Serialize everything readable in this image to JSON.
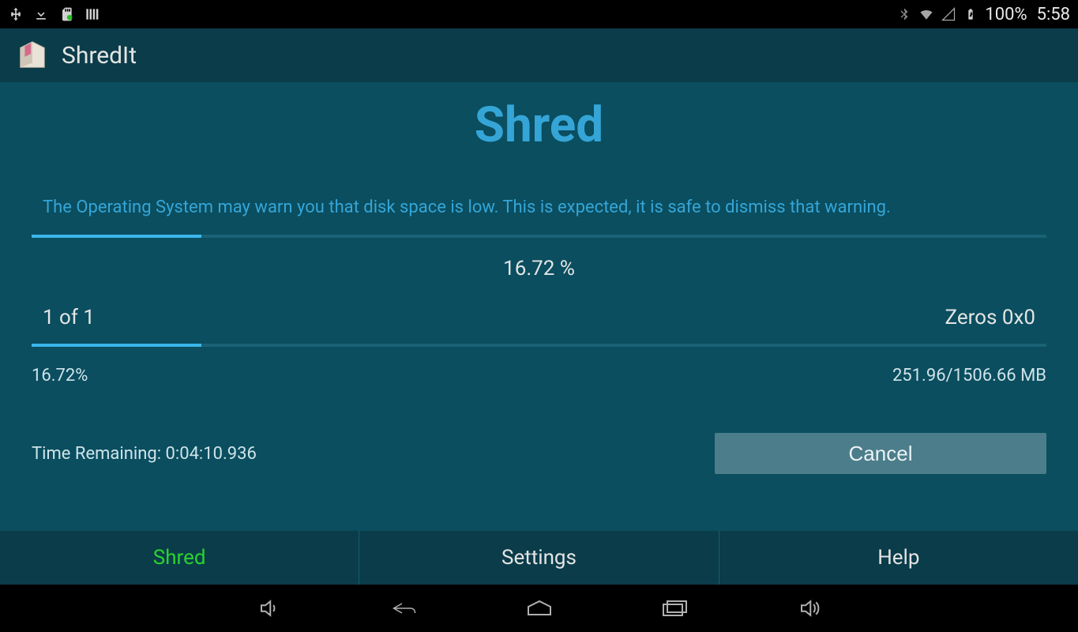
{
  "status_bar": {
    "battery_text": "100%",
    "clock": "5:58"
  },
  "action_bar": {
    "title": "ShredIt"
  },
  "page": {
    "heading": "Shred",
    "warning": "The Operating System may warn you that disk space is low. This is expected, it is safe to dismiss that warning.",
    "overall_progress_percent": 16.72,
    "overall_progress_label": "16.72 %",
    "pass_label": "1 of 1",
    "method_label": "Zeros 0x0",
    "pass_progress_percent": 16.72,
    "pass_progress_label": "16.72%",
    "size_label": "251.96/1506.66 MB",
    "time_remaining_label": "Time Remaining: 0:04:10.936",
    "cancel_label": "Cancel"
  },
  "tabs": {
    "shred": "Shred",
    "settings": "Settings",
    "help": "Help",
    "active": "shred"
  }
}
